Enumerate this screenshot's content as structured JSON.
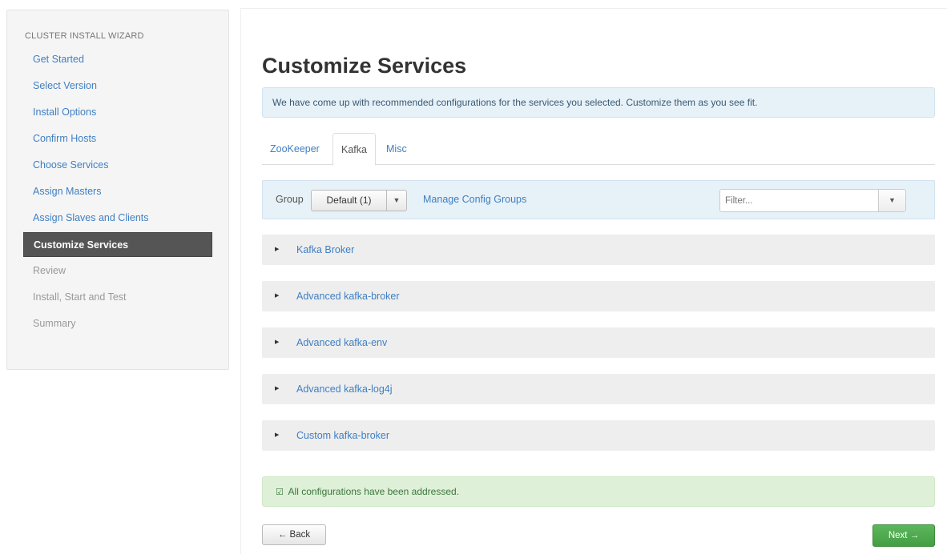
{
  "sidebar": {
    "header": "CLUSTER INSTALL WIZARD",
    "items": [
      {
        "label": "Get Started",
        "state": "link"
      },
      {
        "label": "Select Version",
        "state": "link"
      },
      {
        "label": "Install Options",
        "state": "link"
      },
      {
        "label": "Confirm Hosts",
        "state": "link"
      },
      {
        "label": "Choose Services",
        "state": "link"
      },
      {
        "label": "Assign Masters",
        "state": "link"
      },
      {
        "label": "Assign Slaves and Clients",
        "state": "link"
      },
      {
        "label": "Customize Services",
        "state": "active"
      },
      {
        "label": "Review",
        "state": "disabled"
      },
      {
        "label": "Install, Start and Test",
        "state": "disabled"
      },
      {
        "label": "Summary",
        "state": "disabled"
      }
    ]
  },
  "main": {
    "title": "Customize Services",
    "info_message": "We have come up with recommended configurations for the services you selected. Customize them as you see fit.",
    "tabs": [
      {
        "label": "ZooKeeper",
        "active": false
      },
      {
        "label": "Kafka",
        "active": true
      },
      {
        "label": "Misc",
        "active": false
      }
    ],
    "group_bar": {
      "label": "Group",
      "selected": "Default (1)",
      "manage_link": "Manage Config Groups",
      "filter_placeholder": "Filter..."
    },
    "sections": [
      {
        "title": "Kafka Broker"
      },
      {
        "title": "Advanced kafka-broker"
      },
      {
        "title": "Advanced kafka-env"
      },
      {
        "title": "Advanced kafka-log4j"
      },
      {
        "title": "Custom kafka-broker"
      }
    ],
    "success_message": "All configurations have been addressed.",
    "back_button": "← Back",
    "next_button": "Next →"
  },
  "icons": {
    "check": "check-square-icon",
    "caret": "caret-down-icon",
    "expand": "caret-right-icon"
  },
  "colors": {
    "link": "#3f7fc2",
    "active_nav": "#555555",
    "info_bg": "#e7f1f8",
    "success_bg": "#dff0d8",
    "primary_button": "#5cb85c"
  }
}
